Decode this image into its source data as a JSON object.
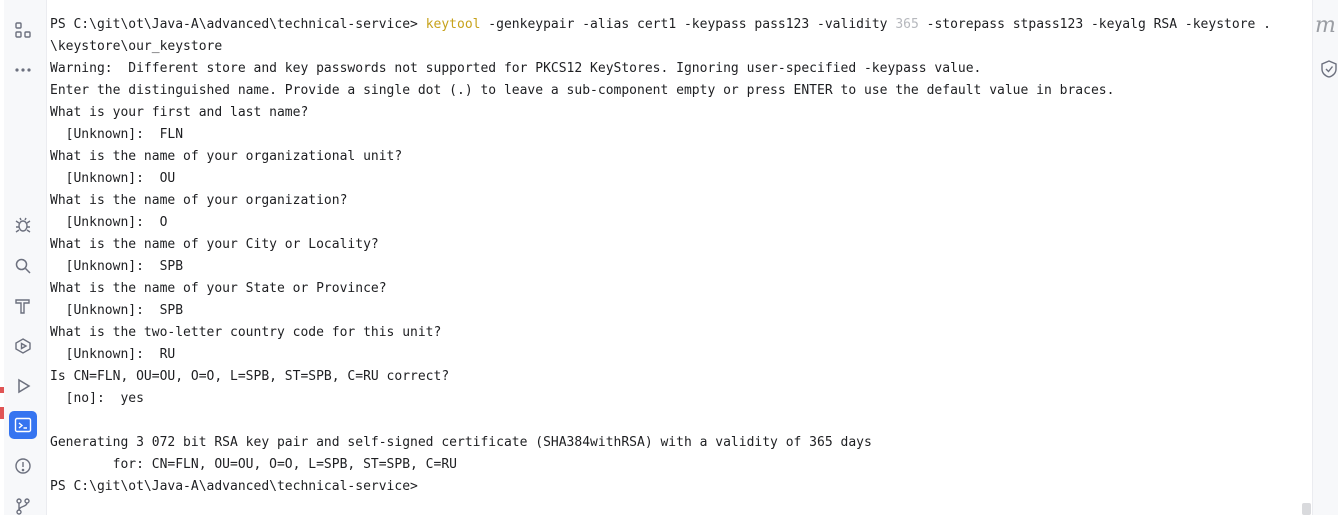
{
  "terminal": {
    "lines": [
      {
        "parts": [
          {
            "text": "PS C:\\git\\ot\\Java-A\\advanced\\technical-service> ",
            "style": "normal"
          },
          {
            "text": "keytool",
            "style": "kw"
          },
          {
            "text": " -genkeypair -alias cert1 -keypass pass123 -validity ",
            "style": "normal"
          },
          {
            "text": "365",
            "style": "dim"
          },
          {
            "text": " -storepass stpass123 -keyalg RSA -keystore .",
            "style": "normal"
          }
        ]
      },
      {
        "parts": [
          {
            "text": "\\keystore\\our_keystore",
            "style": "normal"
          }
        ]
      },
      {
        "parts": [
          {
            "text": "Warning:  Different store and key passwords not supported for PKCS12 KeyStores. Ignoring user-specified -keypass value.",
            "style": "normal"
          }
        ]
      },
      {
        "parts": [
          {
            "text": "Enter the distinguished name. Provide a single dot (.) to leave a sub-component empty or press ENTER to use the default value in braces.",
            "style": "normal"
          }
        ]
      },
      {
        "parts": [
          {
            "text": "What is your first and last name?",
            "style": "normal"
          }
        ]
      },
      {
        "parts": [
          {
            "text": "  [Unknown]:  FLN",
            "style": "normal"
          }
        ]
      },
      {
        "parts": [
          {
            "text": "What is the name of your organizational unit?",
            "style": "normal"
          }
        ]
      },
      {
        "parts": [
          {
            "text": "  [Unknown]:  OU",
            "style": "normal"
          }
        ]
      },
      {
        "parts": [
          {
            "text": "What is the name of your organization?",
            "style": "normal"
          }
        ]
      },
      {
        "parts": [
          {
            "text": "  [Unknown]:  O",
            "style": "normal"
          }
        ]
      },
      {
        "parts": [
          {
            "text": "What is the name of your City or Locality?",
            "style": "normal"
          }
        ]
      },
      {
        "parts": [
          {
            "text": "  [Unknown]:  SPB",
            "style": "normal"
          }
        ]
      },
      {
        "parts": [
          {
            "text": "What is the name of your State or Province?",
            "style": "normal"
          }
        ]
      },
      {
        "parts": [
          {
            "text": "  [Unknown]:  SPB",
            "style": "normal"
          }
        ]
      },
      {
        "parts": [
          {
            "text": "What is the two-letter country code for this unit?",
            "style": "normal"
          }
        ]
      },
      {
        "parts": [
          {
            "text": "  [Unknown]:  RU",
            "style": "normal"
          }
        ]
      },
      {
        "parts": [
          {
            "text": "Is CN=FLN, OU=OU, O=O, L=SPB, ST=SPB, C=RU correct?",
            "style": "normal"
          }
        ]
      },
      {
        "parts": [
          {
            "text": "  [no]:  yes",
            "style": "normal"
          }
        ]
      },
      {
        "parts": [
          {
            "text": "",
            "style": "normal"
          }
        ]
      },
      {
        "parts": [
          {
            "text": "Generating 3 072 bit RSA key pair and self-signed certificate (SHA384withRSA) with a validity of 365 days",
            "style": "normal"
          }
        ]
      },
      {
        "parts": [
          {
            "text": "        for: CN=FLN, OU=OU, O=O, L=SPB, ST=SPB, C=RU",
            "style": "normal"
          }
        ]
      },
      {
        "parts": [
          {
            "text": "PS C:\\git\\ot\\Java-A\\advanced\\technical-service>",
            "style": "normal"
          }
        ]
      }
    ]
  },
  "left_toolbar": {
    "top_icons": [
      "structure-icon",
      "more-icon"
    ],
    "bottom_icons": [
      "debug-icon",
      "search-icon",
      "build-icon",
      "services-icon",
      "run-icon",
      "terminal-icon",
      "problems-icon",
      "git-icon"
    ],
    "active": "terminal-icon"
  },
  "right_toolbar": {
    "letter": "m",
    "icons": [
      "notifications-shield-icon"
    ]
  },
  "colors": {
    "keyword": "#c7a21b",
    "dim_number": "#b6b8bd",
    "text": "#1e1f22",
    "active_tool": "#3574f0"
  }
}
